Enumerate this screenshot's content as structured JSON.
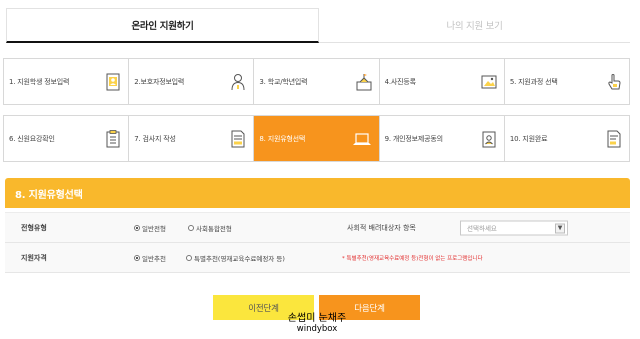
{
  "tabs": [
    {
      "label": "온라인 지원하기",
      "active": true
    },
    {
      "label": "나의 지원 보기",
      "active": false
    }
  ],
  "steps_row1": [
    {
      "label": "1. 지원학생 정보입력",
      "icon": "id-card-icon"
    },
    {
      "label": "2.보호자정보입력",
      "icon": "person-icon"
    },
    {
      "label": "3. 학교/학년입력",
      "icon": "school-icon"
    },
    {
      "label": "4.사진등록",
      "icon": "photo-icon"
    },
    {
      "label": "5. 지원과정 선택",
      "icon": "hand-pointer-icon"
    }
  ],
  "steps_row2": [
    {
      "label": "6. 신원요강확인",
      "icon": "checklist-icon"
    },
    {
      "label": "7. 검사지 작성",
      "icon": "document-icon"
    },
    {
      "label": "8. 지원유형선택",
      "icon": "laptop-icon",
      "active": true
    },
    {
      "label": "9. 개인정보제공동의",
      "icon": "id-badge-icon"
    },
    {
      "label": "10. 지원완료",
      "icon": "document-done-icon"
    }
  ],
  "section": {
    "title": "8. 지원유형선택"
  },
  "form": {
    "row1": {
      "label": "전형유형",
      "radio1": "일반전형",
      "radio2": "사회통합전형",
      "field_label": "사회적 배려대상자 항목",
      "select_value": "선택하세요"
    },
    "row2": {
      "label": "지원자격",
      "radio1": "일반추천",
      "radio2": "특별추천(영재교육수료예정자 등)",
      "note": "* 특별추천(영재교육수료예정 등)전형이 없는 프로그램입니다"
    }
  },
  "buttons": {
    "prev": "이전단계",
    "next": "다음단계"
  },
  "watermark": {
    "line1": "손썹미 눈채주",
    "line2": "windybox"
  },
  "colors": {
    "accent_orange": "#f7941d",
    "header_yellow": "#f9b82c",
    "prev_yellow": "#fbe63d",
    "note_red": "#e22d2d"
  }
}
